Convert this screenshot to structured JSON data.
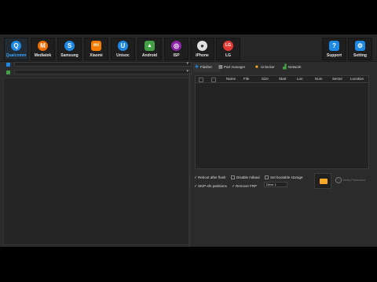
{
  "toolbar": {
    "buttons": [
      {
        "label": "Qualcomm",
        "icon": "Q",
        "color": "#1e88e5",
        "active": true
      },
      {
        "label": "Mediatek",
        "icon": "M",
        "color": "#ef6c00"
      },
      {
        "label": "Samsung",
        "icon": "S",
        "color": "#1e88e5"
      },
      {
        "label": "Xiaomi",
        "icon": "mi",
        "color": "#f57c00"
      },
      {
        "label": "Unisoc",
        "icon": "U",
        "color": "#1e88e5"
      },
      {
        "label": "Android",
        "icon": "🤖",
        "color": "#43a047"
      },
      {
        "label": "ISP",
        "icon": "◎",
        "color": "#8e24aa"
      },
      {
        "label": "iPhone",
        "icon": "",
        "color": "#e0e0e0"
      },
      {
        "label": "LG",
        "icon": "LG",
        "color": "#e53935"
      }
    ],
    "right_buttons": [
      {
        "label": "Support",
        "icon": "?",
        "color": "#1e88e5"
      },
      {
        "label": "Setting",
        "icon": "⚙",
        "color": "#1e88e5"
      }
    ]
  },
  "left": {
    "rows": [
      {
        "checkbox_color": "#1e88e5",
        "value": ""
      },
      {
        "checkbox_color": "#43a047",
        "value": ""
      }
    ]
  },
  "tabs": [
    {
      "label": "Flasher",
      "icon": "✚",
      "color": "#1e88e5",
      "active": true
    },
    {
      "label": "Part manager",
      "icon": "▦",
      "color": "#bbbbbb"
    },
    {
      "label": "Unlocker",
      "icon": "🔒",
      "color": "#f9a825"
    },
    {
      "label": "Network",
      "icon": "▟",
      "color": "#43a047"
    }
  ],
  "table": {
    "columns": [
      "Name",
      "File",
      "Size",
      "Start",
      "Lun",
      "Num",
      "Sector",
      "Location"
    ]
  },
  "options": {
    "reboot_after_flash": "Reboot after flash",
    "disable_mibaul": "Disable mibaul",
    "set_bootable_storage": "Set bootable storage",
    "skip_efs_partitions": "SKIP efs partitions",
    "remove_frp": "Remove FRP",
    "drive_value": "Drive 1",
    "verify_label": "Verify Password"
  },
  "colors": {
    "background": "#2b2b2b",
    "active_accent": "#3fa5ff",
    "folder_icon": "#f9a825"
  }
}
